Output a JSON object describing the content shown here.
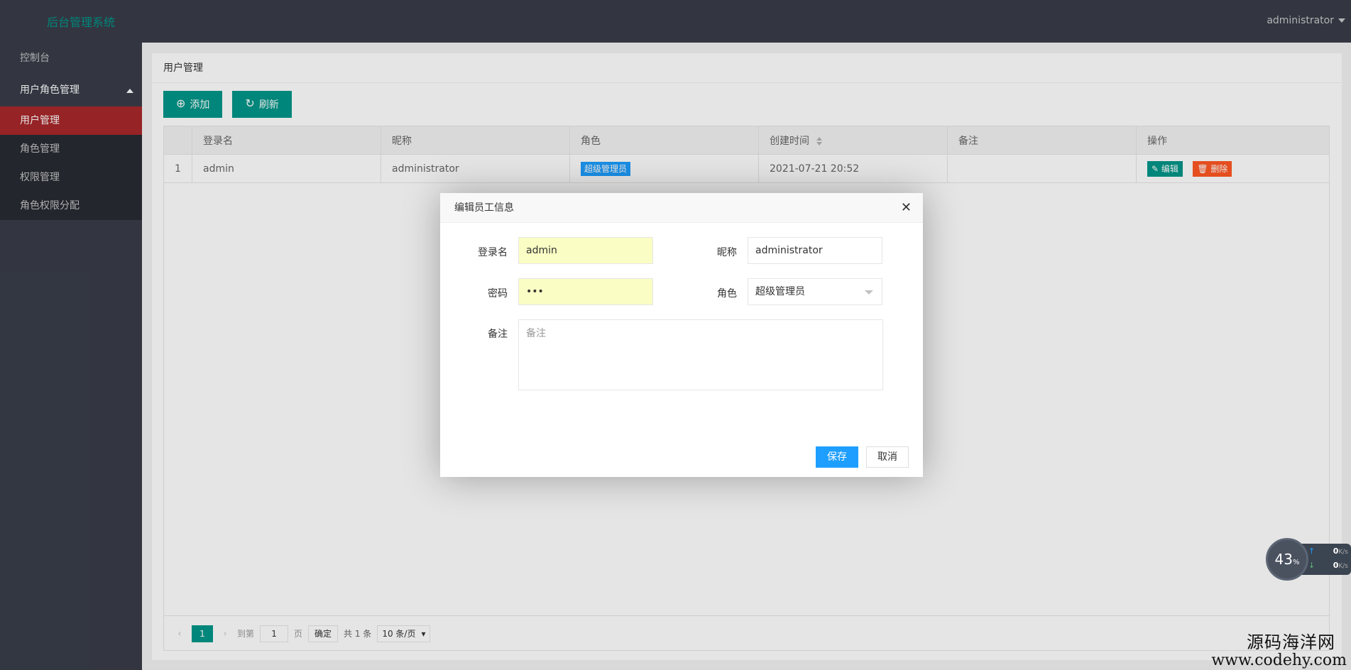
{
  "header": {
    "logo": "后台管理系统",
    "user": "administrator"
  },
  "sidebar": {
    "items": [
      {
        "label": "控制台"
      },
      {
        "label": "用户角色管理"
      }
    ],
    "subitems": [
      {
        "label": "用户管理",
        "active": true
      },
      {
        "label": "角色管理"
      },
      {
        "label": "权限管理"
      },
      {
        "label": "角色权限分配"
      }
    ]
  },
  "page": {
    "title": "用户管理",
    "add_label": "添加",
    "refresh_label": "刷新"
  },
  "table": {
    "columns": [
      "",
      "登录名",
      "昵称",
      "角色",
      "创建时间",
      "备注",
      "操作"
    ],
    "rows": [
      {
        "index": "1",
        "login": "admin",
        "nickname": "administrator",
        "role": "超级管理员",
        "created": "2021-07-21 20:52",
        "remark": ""
      }
    ],
    "edit_label": "编辑",
    "delete_label": "删除"
  },
  "pager": {
    "prev": "‹",
    "current": "1",
    "next": "›",
    "goto_label": "到第",
    "goto_value": "1",
    "page_label": "页",
    "confirm_label": "确定",
    "total_label": "共 1 条",
    "size_label": "10 条/页"
  },
  "modal": {
    "title": "编辑员工信息",
    "close": "✕",
    "login_label": "登录名",
    "login_value": "admin",
    "nickname_label": "昵称",
    "nickname_value": "administrator",
    "password_label": "密码",
    "password_value": "•••",
    "role_label": "角色",
    "role_value": "超级管理员",
    "remark_label": "备注",
    "remark_placeholder": "备注",
    "save_label": "保存",
    "cancel_label": "取消"
  },
  "speed_widget": {
    "percent": "43",
    "percent_unit": "%",
    "up_value": "0",
    "down_value": "0",
    "unit": "K/s"
  },
  "watermark": {
    "line1": "源码海洋网",
    "line2": "www.codehy.com"
  },
  "colors": {
    "header_bg": "#393d49",
    "accent": "#009688",
    "active_nav": "#a8282b",
    "primary_blue": "#1e9fff",
    "danger": "#ff5722"
  }
}
